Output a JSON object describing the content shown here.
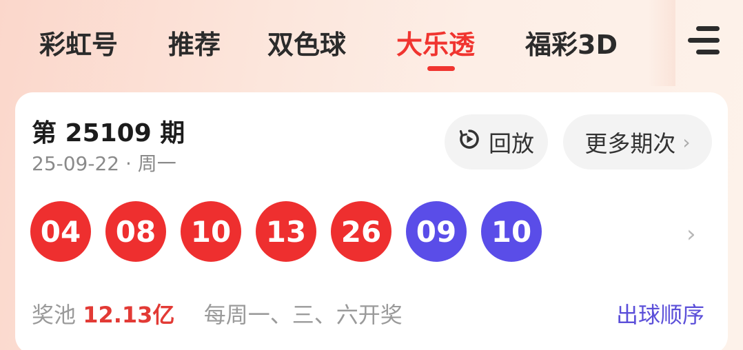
{
  "tabs": [
    {
      "label": "彩虹号",
      "active": false
    },
    {
      "label": "推荐",
      "active": false
    },
    {
      "label": "双色球",
      "active": false
    },
    {
      "label": "大乐透",
      "active": true
    },
    {
      "label": "福彩3D",
      "active": false
    }
  ],
  "draw": {
    "issue": "第 25109 期",
    "date": "25-09-22 · 周一",
    "replay_label": "回放",
    "more_label": "更多期次",
    "front_balls": [
      "04",
      "08",
      "10",
      "13",
      "26"
    ],
    "back_balls": [
      "09",
      "10"
    ],
    "pool_label": "奖池",
    "pool_amount": "12.13亿",
    "schedule": "每周一、三、六开奖",
    "order_link": "出球顺序"
  },
  "colors": {
    "accent": "#f0342f",
    "red_ball": "#ee2f2f",
    "blue_ball": "#5a4de8",
    "link": "#5b4fd9"
  },
  "icons": {
    "menu": "menu-icon",
    "replay": "replay-icon",
    "chevron": "chevron-right-icon"
  }
}
